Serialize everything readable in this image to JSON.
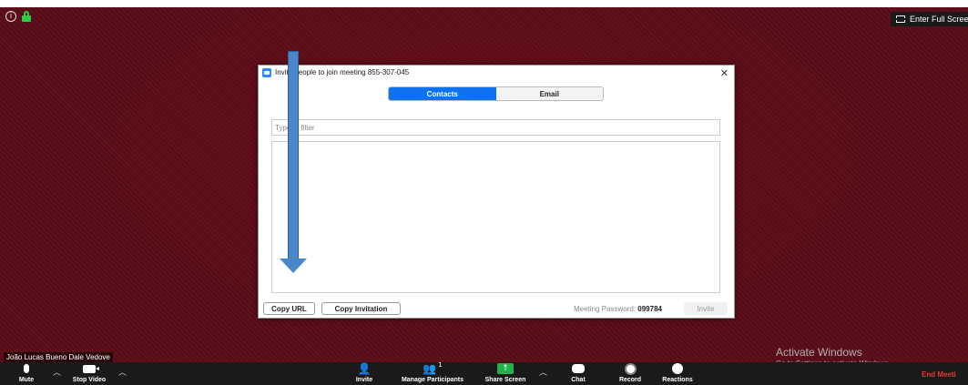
{
  "top": {
    "fullscreen_label": "Enter Full Scree"
  },
  "dialog": {
    "title": "Invite people to join meeting 855-307-045",
    "close": "✕",
    "tabs": [
      {
        "label": "Contacts",
        "active": true
      },
      {
        "label": "Email",
        "active": false
      }
    ],
    "filter_placeholder": "Type to filter",
    "copy_url_label": "Copy URL",
    "copy_invitation_label": "Copy Invitation",
    "password_label": "Meeting Password:",
    "password_value": "099784",
    "invite_label": "Invite"
  },
  "participant_name": "João Lucas Bueno Dale Vedove",
  "toolbar": {
    "mute": "Mute",
    "stop_video": "Stop Video",
    "invite": "Invite",
    "manage_participants": "Manage Participants",
    "participant_count": "1",
    "share_screen": "Share Screen",
    "chat": "Chat",
    "record": "Record",
    "reactions": "Reactions",
    "end_meeting": "End Meeti"
  },
  "watermark": {
    "title": "Activate Windows",
    "subtitle": "Go to Settings to activate Windows."
  },
  "colors": {
    "background": "#5c0d18",
    "accent": "#0e72ed",
    "share_green": "#22b24c",
    "end_red": "#e53935",
    "arrow_blue": "#4a86c8"
  }
}
